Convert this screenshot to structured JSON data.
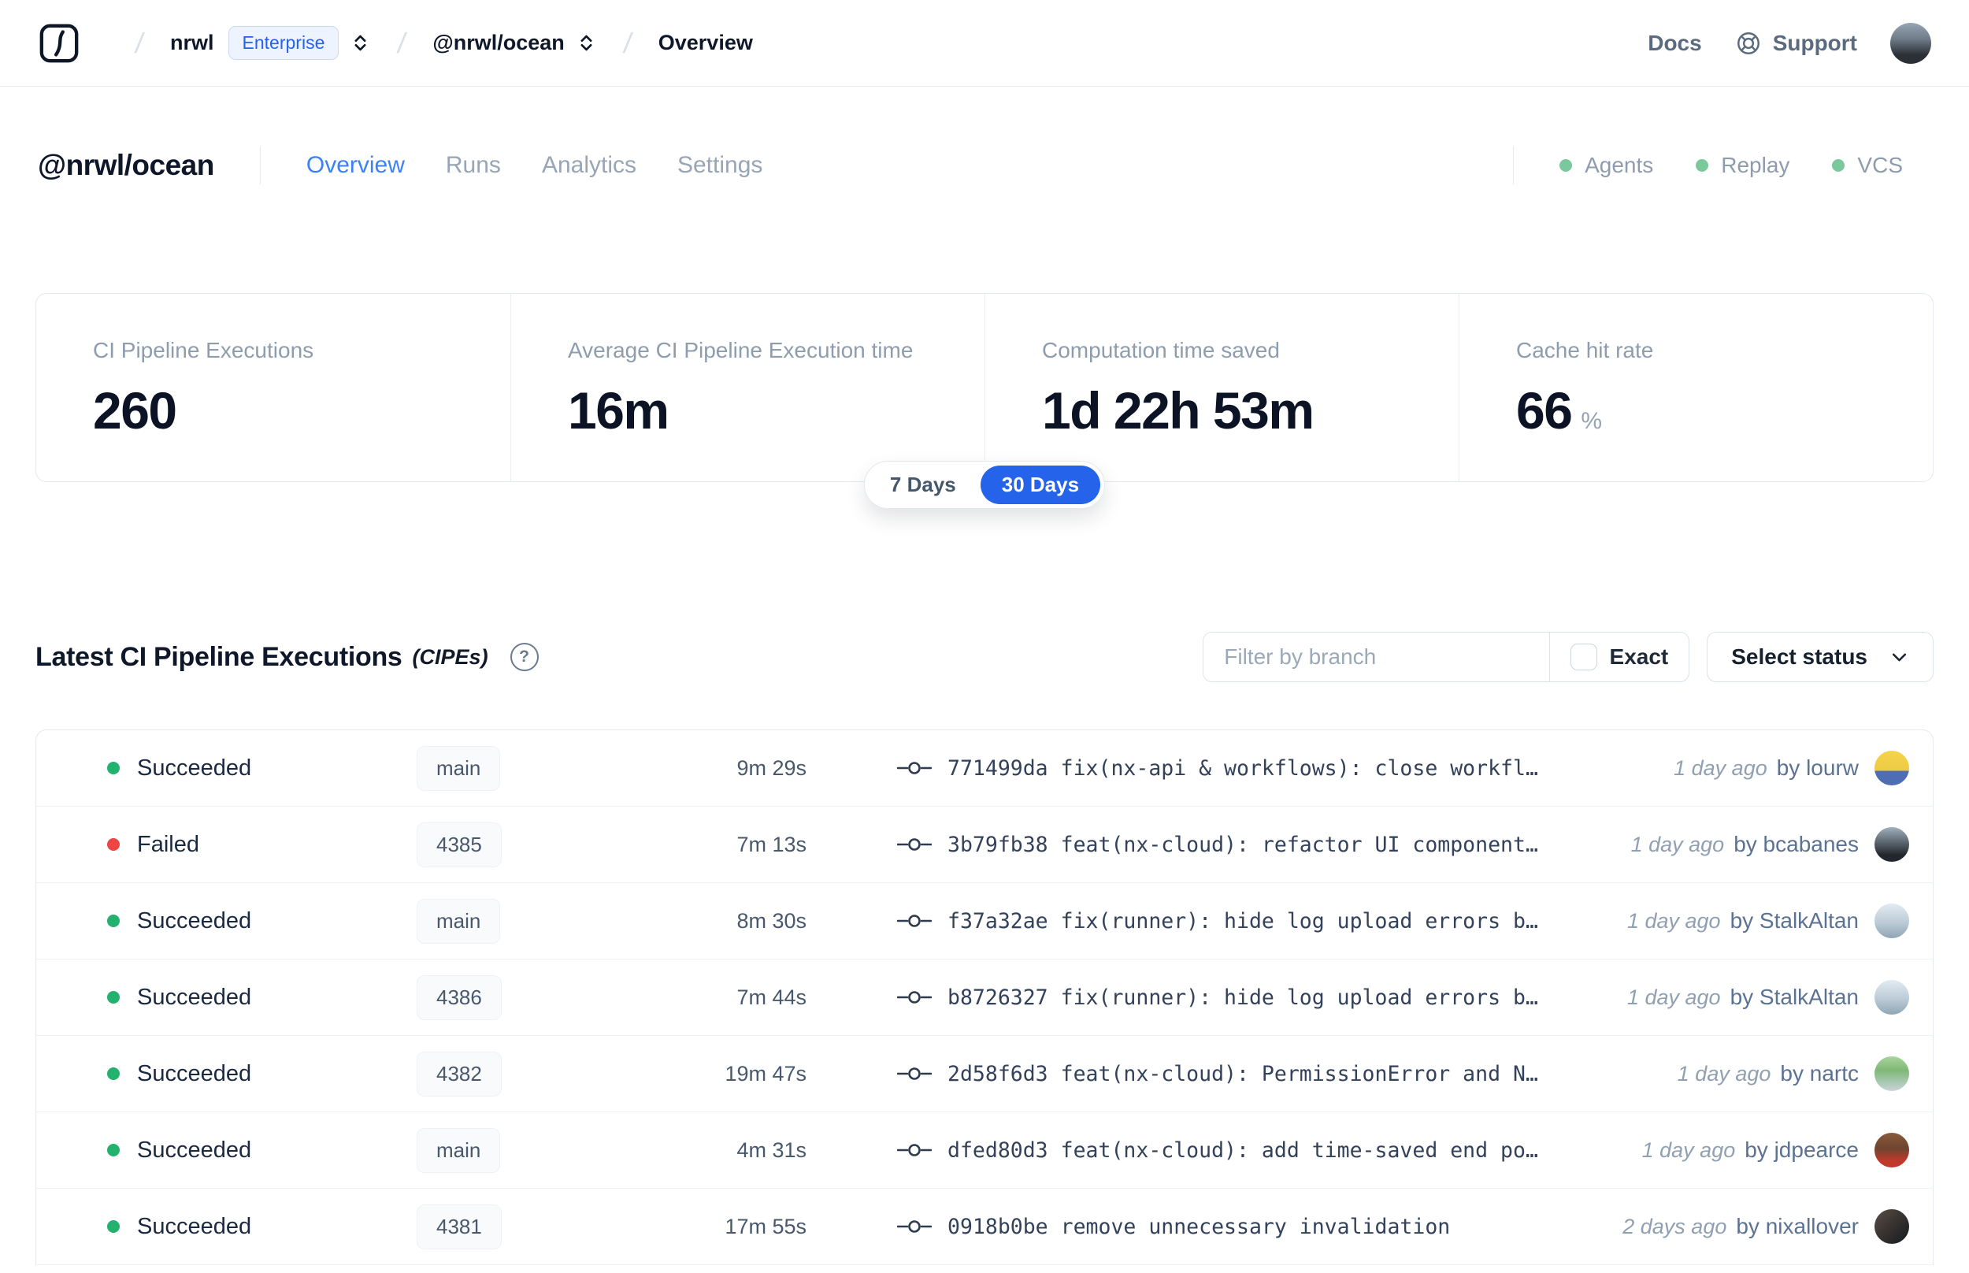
{
  "navbar": {
    "breadcrumb": {
      "org": "nrwl",
      "org_badge": "Enterprise",
      "workspace": "@nrwl/ocean",
      "page": "Overview"
    },
    "links": {
      "docs": "Docs",
      "support": "Support"
    },
    "avatar_style": "background:linear-gradient(180deg,#97a6b4 0%,#6d7b88 40%,#2b3036 78%)"
  },
  "header": {
    "title": "@nrwl/ocean",
    "tabs": [
      {
        "label": "Overview",
        "active": true
      },
      {
        "label": "Runs",
        "active": false
      },
      {
        "label": "Analytics",
        "active": false
      },
      {
        "label": "Settings",
        "active": false
      }
    ],
    "status_badges": [
      "Agents",
      "Replay",
      "VCS"
    ]
  },
  "stats": {
    "cards": [
      {
        "label": "CI Pipeline Executions",
        "value": "260",
        "suffix": ""
      },
      {
        "label": "Average CI Pipeline Execution time",
        "value": "16m",
        "suffix": ""
      },
      {
        "label": "Computation time saved",
        "value": "1d 22h 53m",
        "suffix": ""
      },
      {
        "label": "Cache hit rate",
        "value": "66",
        "suffix": "%"
      }
    ],
    "range_toggle": {
      "options": [
        "7 Days",
        "30 Days"
      ],
      "selected": "30 Days"
    }
  },
  "cipe_section": {
    "title": "Latest CI Pipeline Executions",
    "title_suffix": "(CIPEs)",
    "filter_placeholder": "Filter by branch",
    "exact_label": "Exact",
    "status_select_label": "Select status",
    "rows": [
      {
        "status": "Succeeded",
        "dot_style": "background:#23b26d",
        "branch": "main",
        "duration": "9m 29s",
        "commit_hash": "771499da",
        "commit_message": "fix(nx-api & workflows): close workfl…",
        "time": "1 day ago",
        "author": "by lourw",
        "avatar_style": "background:linear-gradient(180deg,#f5d44c 0%,#edca45 58%,#4e6db3 58%)"
      },
      {
        "status": "Failed",
        "dot_style": "background:#ef4444",
        "branch": "4385",
        "duration": "7m 13s",
        "commit_hash": "3b79fb38",
        "commit_message": "feat(nx-cloud): refactor UI component…",
        "time": "1 day ago",
        "author": "by bcabanes",
        "avatar_style": "background:linear-gradient(180deg,#9fb0bd 0%,#5a646d 45%,#23272d 80%)"
      },
      {
        "status": "Succeeded",
        "dot_style": "background:#23b26d",
        "branch": "main",
        "duration": "8m 30s",
        "commit_hash": "f37a32ae",
        "commit_message": "fix(runner): hide log upload errors b…",
        "time": "1 day ago",
        "author": "by StalkAltan",
        "avatar_style": "background:linear-gradient(180deg,#e3ebf1 0%,#bccbd7 55%,#8fa5b5 100%)"
      },
      {
        "status": "Succeeded",
        "dot_style": "background:#23b26d",
        "branch": "4386",
        "duration": "7m 44s",
        "commit_hash": "b8726327",
        "commit_message": "fix(runner): hide log upload errors b…",
        "time": "1 day ago",
        "author": "by StalkAltan",
        "avatar_style": "background:linear-gradient(180deg,#e3ebf1 0%,#bccbd7 55%,#8fa5b5 100%)"
      },
      {
        "status": "Succeeded",
        "dot_style": "background:#23b26d",
        "branch": "4382",
        "duration": "19m 47s",
        "commit_hash": "2d58f6d3",
        "commit_message": "feat(nx-cloud): PermissionError and N…",
        "time": "1 day ago",
        "author": "by nartc",
        "avatar_style": "background:linear-gradient(180deg,#a8d49a 0%,#7fb877 40%,#c9d4dc 100%)"
      },
      {
        "status": "Succeeded",
        "dot_style": "background:#23b26d",
        "branch": "main",
        "duration": "4m 31s",
        "commit_hash": "dfed80d3",
        "commit_message": "feat(nx-cloud): add time-saved end po…",
        "time": "1 day ago",
        "author": "by jdpearce",
        "avatar_style": "background:linear-gradient(180deg,#8a5a3b 0%,#6e4530 45%,#c0392b 80%)"
      },
      {
        "status": "Succeeded",
        "dot_style": "background:#23b26d",
        "branch": "4381",
        "duration": "17m 55s",
        "commit_hash": "0918b0be",
        "commit_message": "remove unnecessary invalidation",
        "time": "2 days ago",
        "author": "by nixallover",
        "avatar_style": "background:linear-gradient(135deg,#5a4d46 0%,#3a3532 45%,#1f2225 85%)"
      }
    ]
  },
  "colors": {
    "accent_blue": "#2563eb",
    "tab_active_blue": "#3b82f6",
    "success_green": "#23b26d",
    "failed_red": "#ef4444",
    "feature_dot_green": "#7cc89d",
    "enterprise_badge_bg": "#eef4ff",
    "enterprise_badge_text": "#2563eb"
  }
}
